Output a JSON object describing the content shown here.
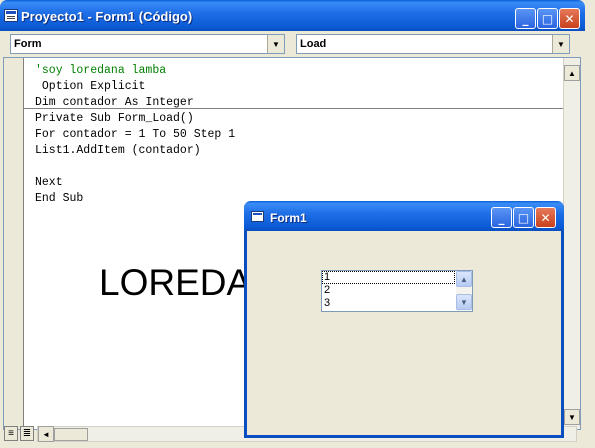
{
  "window": {
    "title": "Proyecto1 - Form1 (Código)",
    "minimize_glyph": "_",
    "maximize_glyph": "□",
    "close_glyph": "✕"
  },
  "object_combo": {
    "value": "Form"
  },
  "procedure_combo": {
    "value": "Load"
  },
  "code_lines": [
    {
      "text": "'soy loredana lamba",
      "type": "comment"
    },
    {
      "text": " Option Explicit",
      "type": "code"
    },
    {
      "text": "Dim contador As Integer",
      "type": "code"
    },
    {
      "text": "Private Sub Form_Load()",
      "type": "code"
    },
    {
      "text": "For contador = 1 To 50 Step 1",
      "type": "code"
    },
    {
      "text": "List1.AddItem (contador)",
      "type": "code"
    },
    {
      "text": "",
      "type": "code"
    },
    {
      "text": "Next",
      "type": "code"
    },
    {
      "text": "End Sub",
      "type": "code"
    }
  ],
  "label_text": "LOREDANA",
  "form1": {
    "title": "Form1",
    "list_items": [
      "1",
      "2",
      "3"
    ]
  },
  "icons": {
    "dropdown": "▼",
    "scroll_up": "▲",
    "scroll_down": "▼",
    "scroll_left": "◄",
    "procedure_view": "≡",
    "module_view": "≣"
  },
  "colors": {
    "title_bar": "#0b5bd6",
    "comment": "#007f00",
    "close_button": "#c8401c"
  }
}
